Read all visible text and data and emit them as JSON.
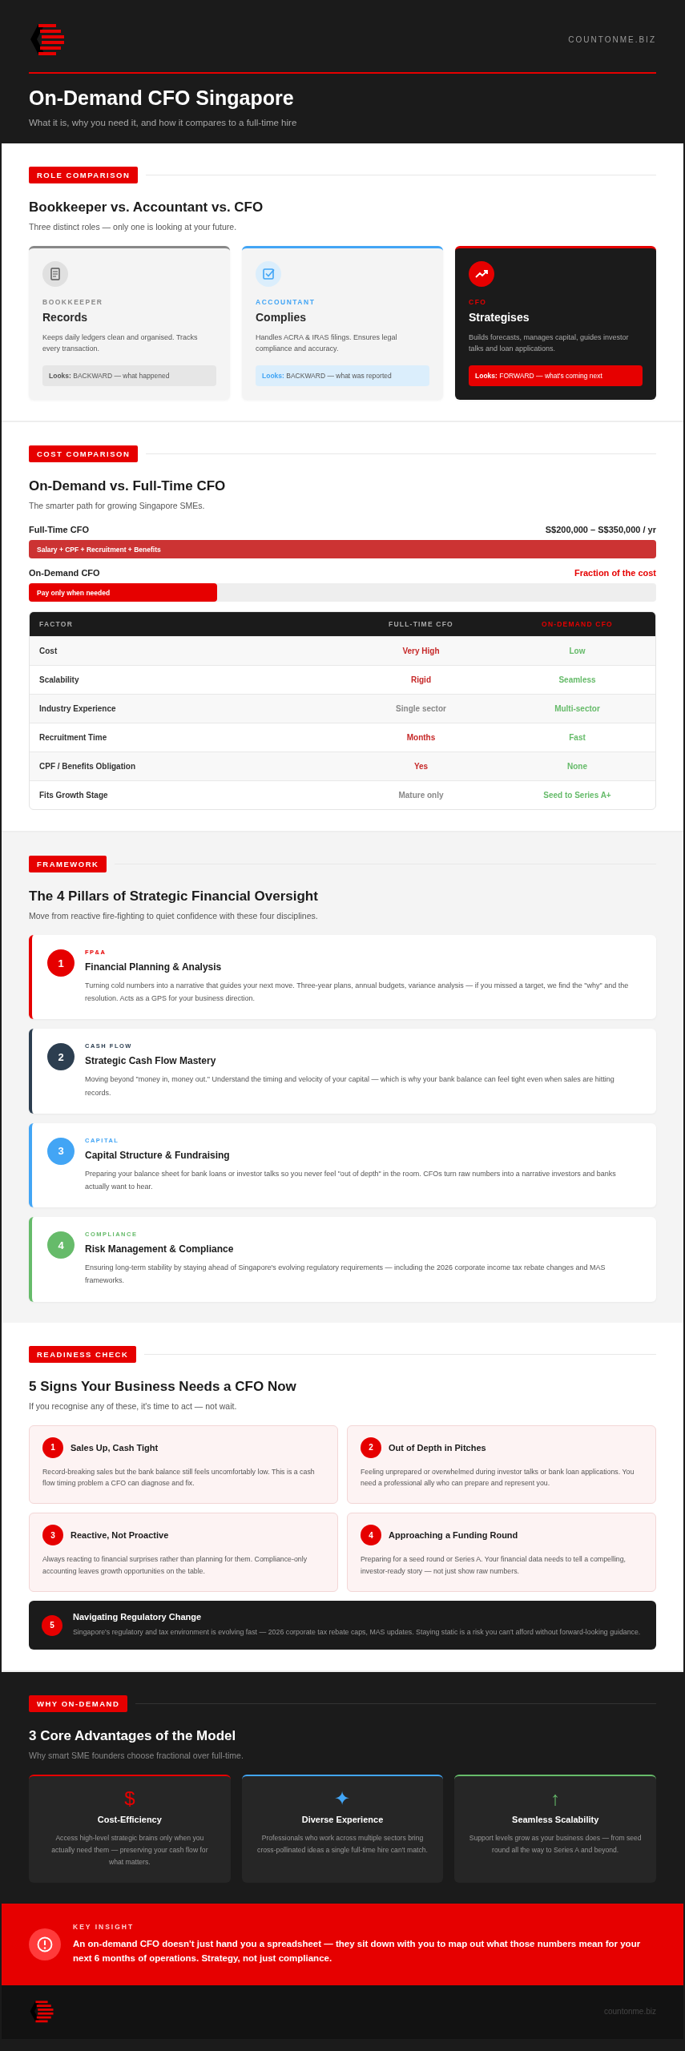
{
  "header": {
    "site": "COUNTONME.BIZ",
    "title": "On-Demand CFO Singapore",
    "subtitle": "What it is, why you need it, and how it compares to a full-time hire"
  },
  "roles": {
    "badge": "ROLE COMPARISON",
    "title": "Bookkeeper vs. Accountant vs. CFO",
    "subtitle": "Three distinct roles — only one is looking at your future.",
    "cards": [
      {
        "label": "BOOKKEEPER",
        "title": "Records",
        "text": "Keeps daily ledgers clean and organised. Tracks every transaction.",
        "looks_label": "Looks:",
        "looks": "BACKWARD — what happened",
        "color": "#888888",
        "featured": false
      },
      {
        "label": "ACCOUNTANT",
        "title": "Complies",
        "text": "Handles ACRA & IRAS filings. Ensures legal compliance and accuracy.",
        "looks_label": "Looks:",
        "looks": "BACKWARD — what was reported",
        "color": "#42a5f5",
        "featured": false
      },
      {
        "label": "CFO",
        "title": "Strategises",
        "text": "Builds forecasts, manages capital, guides investor talks and loan applications.",
        "looks_label": "Looks:",
        "looks": "FORWARD — what's coming next",
        "color": "#e60000",
        "featured": true
      }
    ]
  },
  "cost": {
    "badge": "COST COMPARISON",
    "title": "On-Demand vs. Full-Time CFO",
    "subtitle": "The smarter path for growing Singapore SMEs.",
    "bars": [
      {
        "label": "Full-Time CFO",
        "value": "S$200,000 – S$350,000 / yr",
        "bar_text": "Salary + CPF + Recruitment + Benefits",
        "level": 1,
        "highlight": false
      },
      {
        "label": "On-Demand CFO",
        "value": "Fraction of the cost",
        "bar_text": "Pay only when needed",
        "level": 0.3,
        "highlight": true
      }
    ],
    "table": {
      "columns": [
        "FACTOR",
        "FULL-TIME CFO",
        "ON-DEMAND CFO"
      ],
      "rows": [
        {
          "factor": "Cost",
          "full_time": {
            "text": "Very High",
            "kind": "negative"
          },
          "on_demand": {
            "text": "Low",
            "kind": "positive"
          }
        },
        {
          "factor": "Scalability",
          "full_time": {
            "text": "Rigid",
            "kind": "negative"
          },
          "on_demand": {
            "text": "Seamless",
            "kind": "positive"
          }
        },
        {
          "factor": "Industry Experience",
          "full_time": {
            "text": "Single sector",
            "kind": "neutral"
          },
          "on_demand": {
            "text": "Multi-sector",
            "kind": "positive"
          }
        },
        {
          "factor": "Recruitment Time",
          "full_time": {
            "text": "Months",
            "kind": "negative"
          },
          "on_demand": {
            "text": "Fast",
            "kind": "positive"
          }
        },
        {
          "factor": "CPF / Benefits Obligation",
          "full_time": {
            "text": "Yes",
            "kind": "negative"
          },
          "on_demand": {
            "text": "None",
            "kind": "positive"
          }
        },
        {
          "factor": "Fits Growth Stage",
          "full_time": {
            "text": "Mature only",
            "kind": "neutral"
          },
          "on_demand": {
            "text": "Seed to Series A+",
            "kind": "positive"
          }
        }
      ]
    }
  },
  "framework": {
    "badge": "FRAMEWORK",
    "title": "The 4 Pillars of Strategic Financial Oversight",
    "subtitle": "Move from reactive fire-fighting to quiet confidence with these four disciplines.",
    "pillars": [
      {
        "number": "1",
        "tag": "FP&A",
        "title": "Financial Planning & Analysis",
        "text": "Turning cold numbers into a narrative that guides your next move. Three-year plans, annual budgets, variance analysis — if you missed a target, we find the \"why\" and the resolution. Acts as a GPS for your business direction.",
        "color": "#e60000"
      },
      {
        "number": "2",
        "tag": "CASH FLOW",
        "title": "Strategic Cash Flow Mastery",
        "text": "Moving beyond \"money in, money out.\" Understand the timing and velocity of your capital — which is why your bank balance can feel tight even when sales are hitting records.",
        "color": "#2c3e50"
      },
      {
        "number": "3",
        "tag": "CAPITAL",
        "title": "Capital Structure & Fundraising",
        "text": "Preparing your balance sheet for bank loans or investor talks so you never feel \"out of depth\" in the room. CFOs turn raw numbers into a narrative investors and banks actually want to hear.",
        "color": "#42a5f5"
      },
      {
        "number": "4",
        "tag": "COMPLIANCE",
        "title": "Risk Management & Compliance",
        "text": "Ensuring long-term stability by staying ahead of Singapore's evolving regulatory requirements — including the 2026 corporate income tax rebate changes and MAS frameworks.",
        "color": "#66bb6a"
      }
    ]
  },
  "readiness": {
    "badge": "READINESS CHECK",
    "title": "5 Signs Your Business Needs a CFO Now",
    "subtitle": "If you recognise any of these, it's time to act — not wait.",
    "signs": [
      {
        "number": "1",
        "title": "Sales Up, Cash Tight",
        "text": "Record-breaking sales but the bank balance still feels uncomfortably low. This is a cash flow timing problem a CFO can diagnose and fix.",
        "kind": "card"
      },
      {
        "number": "2",
        "title": "Out of Depth in Pitches",
        "text": "Feeling unprepared or overwhelmed during investor talks or bank loan applications. You need a professional ally who can prepare and represent you.",
        "kind": "card"
      },
      {
        "number": "3",
        "title": "Reactive, Not Proactive",
        "text": "Always reacting to financial surprises rather than planning for them. Compliance-only accounting leaves growth opportunities on the table.",
        "kind": "card"
      },
      {
        "number": "4",
        "title": "Approaching a Funding Round",
        "text": "Preparing for a seed round or Series A. Your financial data needs to tell a compelling, investor-ready story — not just show raw numbers.",
        "kind": "card"
      },
      {
        "number": "5",
        "title": "Navigating Regulatory Change",
        "text": "Singapore's regulatory and tax environment is evolving fast — 2026 corporate tax rebate caps, MAS updates. Staying static is a risk you can't afford without forward-looking guidance.",
        "kind": "banner"
      }
    ]
  },
  "advantages": {
    "badge": "WHY ON-DEMAND",
    "title": "3 Core Advantages of the Model",
    "subtitle": "Why smart SME founders choose fractional over full-time.",
    "items": [
      {
        "symbol": "$",
        "title": "Cost-Efficiency",
        "text": "Access high-level strategic brains only when you actually need them — preserving your cash flow for what matters.",
        "color": "#e60000"
      },
      {
        "symbol": "✦",
        "title": "Diverse Experience",
        "text": "Professionals who work across multiple sectors bring cross-pollinated ideas a single full-time hire can't match.",
        "color": "#42a5f5"
      },
      {
        "symbol": "↑",
        "title": "Seamless Scalability",
        "text": "Support levels grow as your business does — from seed round all the way to Series A and beyond.",
        "color": "#66bb6a"
      }
    ]
  },
  "insight": {
    "label": "KEY INSIGHT",
    "text": "An on-demand CFO doesn't just hand you a spreadsheet — they sit down with you to map out what those numbers mean for your next 6 months of operations. Strategy, not just compliance."
  },
  "footer": {
    "site": "countonme.biz"
  }
}
